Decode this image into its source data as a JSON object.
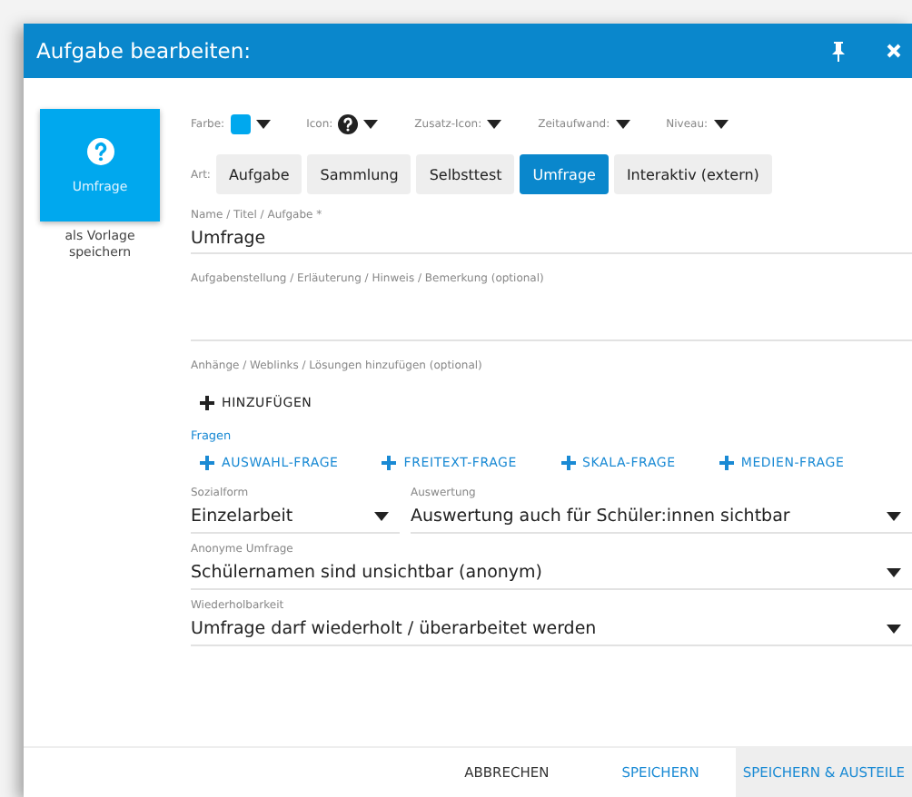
{
  "window": {
    "title": "Aufgabe bearbeiten:"
  },
  "preview": {
    "label": "Umfrage",
    "color": "#00a8ee"
  },
  "template_link": "als Vorlage speichern",
  "toolbar": [
    {
      "kind": "color",
      "label": "Farbe:",
      "color": "#00a8ee"
    },
    {
      "kind": "icon",
      "label": "Icon:"
    },
    {
      "kind": "plain",
      "label": "Zusatz-Icon:"
    },
    {
      "kind": "plain",
      "label": "Zeitaufwand:"
    },
    {
      "kind": "plain",
      "label": "Niveau:"
    }
  ],
  "type": {
    "label": "Art:",
    "options": [
      {
        "label": "Aufgabe",
        "selected": false
      },
      {
        "label": "Sammlung",
        "selected": false
      },
      {
        "label": "Selbsttest",
        "selected": false
      },
      {
        "label": "Umfrage",
        "selected": true
      },
      {
        "label": "Interaktiv (extern)",
        "selected": false
      }
    ]
  },
  "name_field": {
    "label": "Name / Titel / Aufgabe *",
    "value": "Umfrage"
  },
  "description_field": {
    "label": "Aufgabenstellung / Erläuterung / Hinweis / Bemerkung (optional)"
  },
  "attachments": {
    "label": "Anhänge / Weblinks / Lösungen hinzufügen (optional)",
    "button": "HINZUFÜGEN"
  },
  "questions": {
    "label": "Fragen",
    "buttons": [
      "AUSWAHL-FRAGE",
      "FREITEXT-FRAGE",
      "SKALA-FRAGE",
      "MEDIEN-FRAGE"
    ]
  },
  "select_rows": [
    [
      {
        "label": "Sozialform",
        "value": "Einzelarbeit"
      },
      {
        "label": "Auswertung",
        "value": "Auswertung auch für Schüler:innen sichtbar"
      }
    ],
    [
      {
        "label": "Anonyme Umfrage",
        "value": "Schülernamen sind unsichtbar (anonym)"
      }
    ],
    [
      {
        "label": "Wiederholbarkeit",
        "value": "Umfrage darf wiederholt / überarbeitet werden"
      }
    ]
  ],
  "footer": {
    "buttons": [
      {
        "label": "ABBRECHEN",
        "kind": "plain"
      },
      {
        "label": "SPEICHERN",
        "kind": "primary"
      },
      {
        "label": "SPEICHERN & AUSTEILE",
        "kind": "filled"
      }
    ]
  }
}
